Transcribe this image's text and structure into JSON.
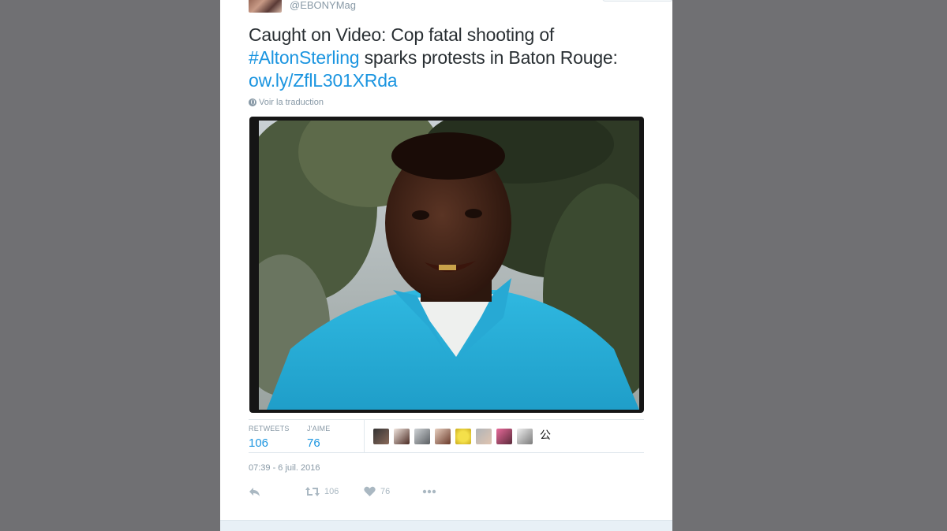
{
  "tweet": {
    "handle": "@EBONYMag",
    "text_line1": "Caught on Video: Cop fatal shooting of",
    "hashtag": "#AltonSterling",
    "text_line2_rest": " sparks protests in Baton Rouge:",
    "link": "ow.ly/ZflL301XRda",
    "translate_label": "Voir la traduction"
  },
  "stats": {
    "retweets_label": "RETWEETS",
    "retweets_value": "106",
    "likes_label": "J'AIME",
    "likes_value": "76"
  },
  "likers": {
    "last_glyph": "公"
  },
  "timestamp": "07:39 - 6 juil. 2016",
  "actions": {
    "retweet_count": "106",
    "like_count": "76"
  },
  "colors": {
    "link": "#1b95e0",
    "text": "#292f33",
    "muted": "#8899a6",
    "background": "#707073"
  }
}
